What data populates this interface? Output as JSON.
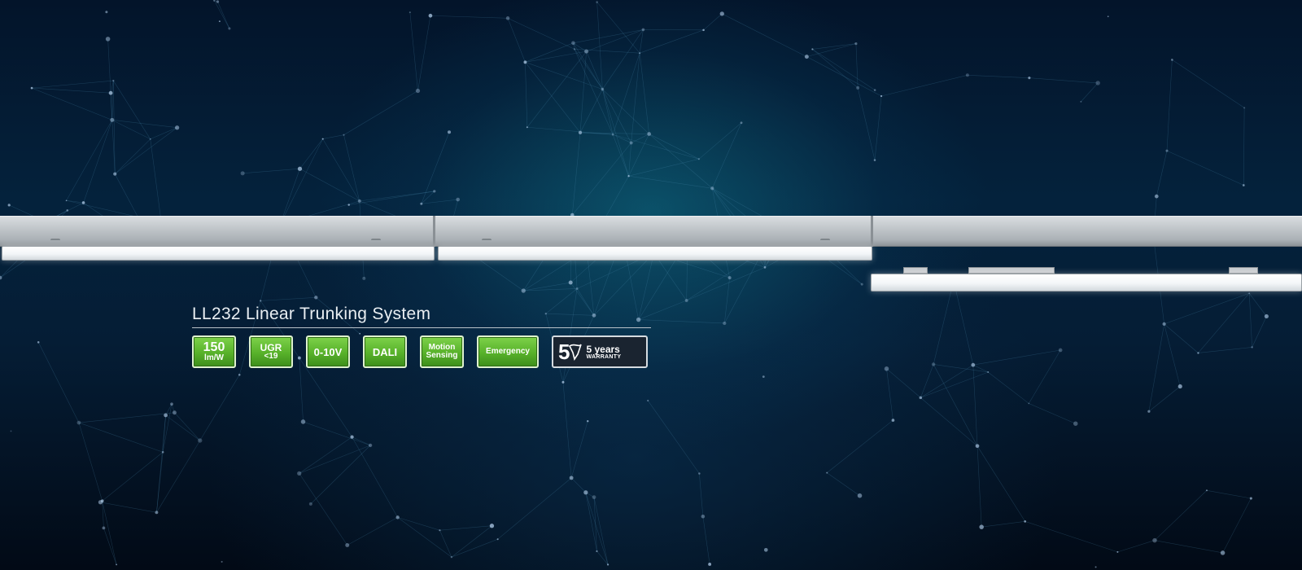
{
  "banner": {
    "title": "LL232 Linear Trunking System",
    "badges": [
      {
        "line1": "150",
        "line2": "lm/W",
        "color": "#5cb82f"
      },
      {
        "line1": "UGR",
        "line2": "<19",
        "color": "#5cb82f"
      },
      {
        "line1": "0-10V",
        "color": "#5cb82f"
      },
      {
        "line1": "DALI",
        "color": "#5cb82f"
      },
      {
        "line1": "Motion",
        "line2": "Sensing",
        "color": "#5cb82f"
      },
      {
        "line1": "Emergency",
        "color": "#5cb82f"
      }
    ],
    "warranty": {
      "number": "5",
      "years": "5 years",
      "label": "WARRANTY"
    }
  },
  "colors": {
    "background": "#04223c",
    "accent_green": "#5cb82f",
    "rail": "#c4c9cd"
  }
}
